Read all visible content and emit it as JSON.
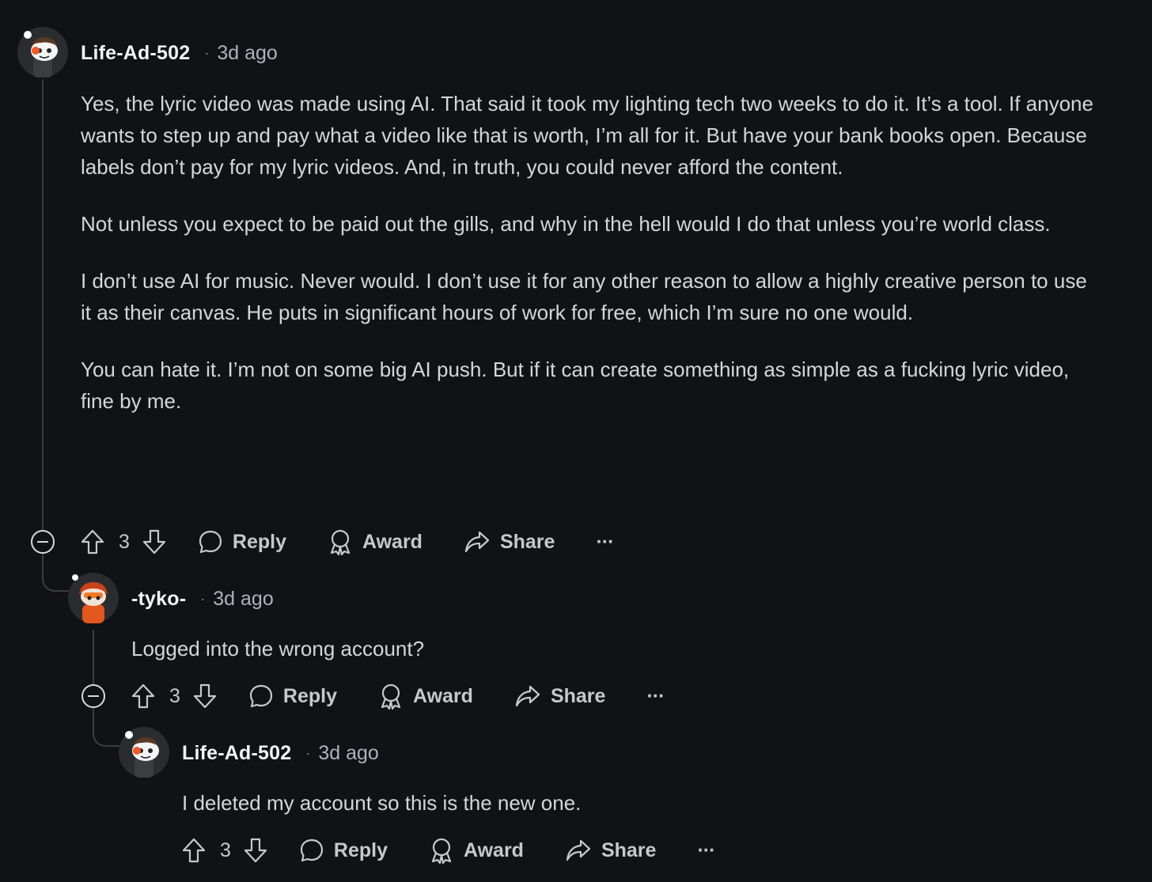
{
  "comments": [
    {
      "username": "Life-Ad-502",
      "separator": "·",
      "time": "3d ago",
      "paragraphs": [
        "Yes, the lyric video was made using AI. That said it took my lighting tech two weeks to do it. It’s a tool. If anyone wants to step up and pay what a video like that is worth, I’m all for it. But have your bank books open. Because labels don’t pay for my lyric videos. And, in truth, you could never afford the content.",
        "Not unless you expect to be paid out the gills, and why in the hell would I do that unless you’re world class.",
        "I don’t use AI for music. Never would. I don’t use it for any other reason to allow a highly creative person to use it as their canvas. He puts in significant hours of work for free, which I’m sure no one would.",
        "You can hate it. I’m not on some big AI push. But if it can create something as simple as a fucking lyric video, fine by me."
      ],
      "votes": "3",
      "reply_label": "Reply",
      "award_label": "Award",
      "share_label": "Share",
      "more_label": "···"
    },
    {
      "username": "-tyko-",
      "separator": "·",
      "time": "3d ago",
      "paragraphs": [
        "Logged into the wrong account?"
      ],
      "votes": "3",
      "reply_label": "Reply",
      "award_label": "Award",
      "share_label": "Share",
      "more_label": "···"
    },
    {
      "username": "Life-Ad-502",
      "separator": "·",
      "time": "3d ago",
      "paragraphs": [
        "I deleted my account so this is the new one."
      ],
      "votes": "3",
      "reply_label": "Reply",
      "award_label": "Award",
      "share_label": "Share",
      "more_label": "···"
    }
  ],
  "icons": {
    "upvote": "arrow-up-icon",
    "downvote": "arrow-down-icon",
    "reply": "speech-bubble-icon",
    "award": "award-ribbon-icon",
    "share": "share-arrow-icon",
    "more": "ellipsis-icon",
    "collapse": "collapse-minus-icon"
  },
  "colors": {
    "background": "#111215",
    "username": "#f2f3f5",
    "text": "#d4d7da",
    "muted": "#aeb3b8",
    "thread_line": "#3a3c3f",
    "tyko_avatar": "#e2571e"
  }
}
